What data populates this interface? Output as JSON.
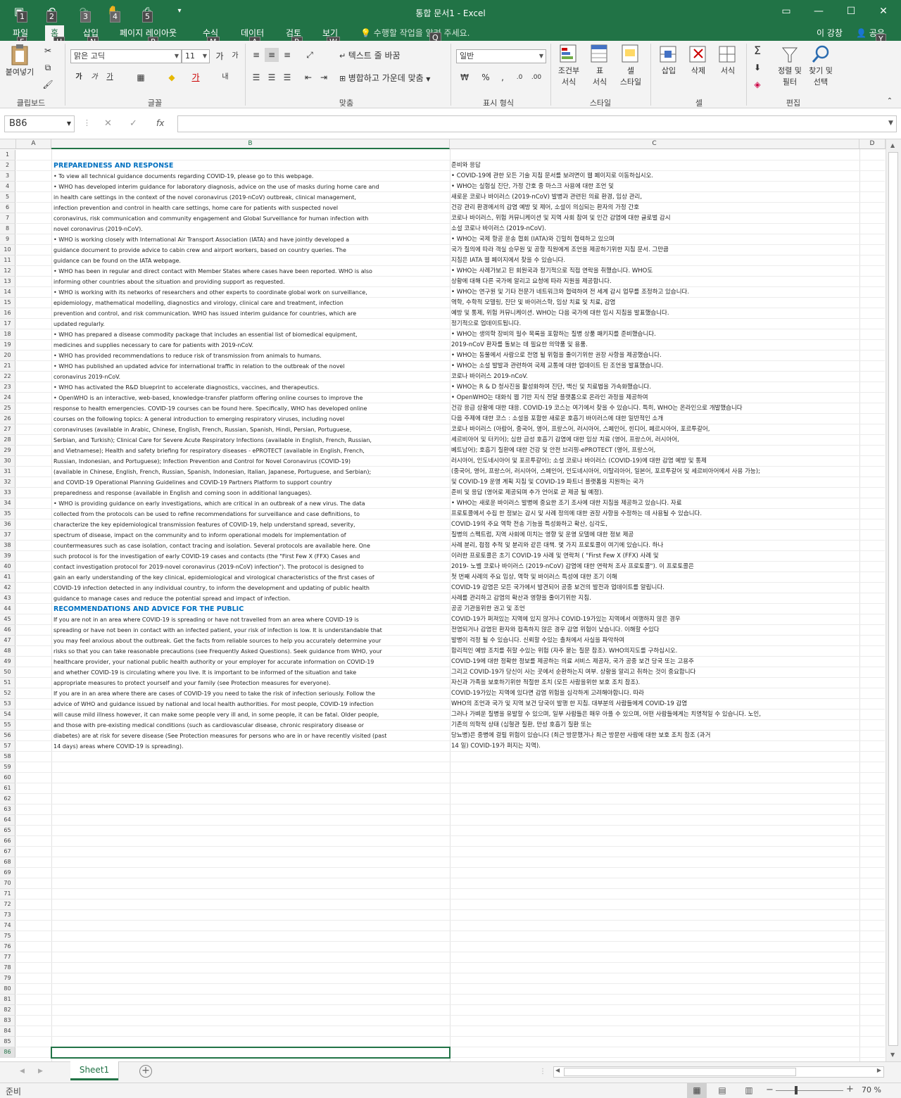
{
  "window": {
    "title": "통합 문서1 - Excel",
    "user": "이 강창",
    "share": "공유"
  },
  "qat_keys": [
    "1",
    "2",
    "3",
    "4",
    "5"
  ],
  "tabs": [
    {
      "label": "파일",
      "key": "F"
    },
    {
      "label": "홈",
      "key": "H"
    },
    {
      "label": "삽입",
      "key": "N"
    },
    {
      "label": "페이지 레이아웃",
      "key": "P"
    },
    {
      "label": "수식",
      "key": "M"
    },
    {
      "label": "데이터",
      "key": "A"
    },
    {
      "label": "검토",
      "key": "R"
    },
    {
      "label": "보기",
      "key": "W"
    }
  ],
  "tell_me": {
    "text": "수행할 작업을 알려 주세요.",
    "key": "Q"
  },
  "share_key": "Y",
  "ribbon": {
    "paste": "붙여넣기",
    "font_name": "맑은 고딕",
    "font_size": "11",
    "bold": "가",
    "italic": "가",
    "underline": "가",
    "wrap_text": "텍스트 줄 바꿈",
    "merge_center": "병합하고 가운데 맞춤",
    "number_format": "일반",
    "cond_format": [
      "조건부",
      "서식"
    ],
    "format_table": [
      "표",
      "서식"
    ],
    "cell_styles": [
      "셀",
      "스타일"
    ],
    "insert": "삽입",
    "delete": "삭제",
    "format": "서식",
    "sort_filter": [
      "정렬 및",
      "필터"
    ],
    "find_select": [
      "찾기 및",
      "선택"
    ],
    "groups": [
      "클립보드",
      "글꼴",
      "맞춤",
      "표시 형식",
      "스타일",
      "셀",
      "편집"
    ]
  },
  "formula_bar": {
    "name_box": "B86",
    "fx": "fx",
    "value": ""
  },
  "columns": [
    "A",
    "B",
    "C",
    "D"
  ],
  "rows_count": 86,
  "cells": {
    "B2": "PREPAREDNESS AND RESPONSE",
    "B3": "• To view all technical guidance documents regarding COVID-19, please go to this webpage.",
    "B4": "• WHO has developed interim guidance for laboratory diagnosis, advice on the use of masks during home care and",
    "B5": "in health care settings in the context of the novel coronavirus (2019-nCoV) outbreak, clinical management,",
    "B6": "infection prevention and control in health care settings, home care for patients with suspected novel",
    "B7": "coronavirus, risk communication and community engagement and Global Surveillance for human infection with",
    "B8": "novel coronavirus (2019-nCoV).",
    "B9": "• WHO is working closely with International Air Transport Association (IATA) and have jointly developed a",
    "B10": "guidance document to provide advice to cabin crew and airport workers, based on country queries. The",
    "B11": "guidance can be found on the IATA webpage.",
    "B12": "• WHO has been in regular and direct contact with Member States where cases have been reported. WHO is also",
    "B13": "informing other countries about the situation and providing support as requested.",
    "B14": "• WHO is working with its networks of researchers and other experts to coordinate global work on surveillance,",
    "B15": "epidemiology, mathematical modelling, diagnostics and virology, clinical care and treatment, infection",
    "B16": "prevention and control, and risk communication. WHO has issued interim guidance for countries, which are",
    "B17": "updated regularly.",
    "B18": "• WHO has prepared a disease commodity package that includes an essential list of biomedical equipment,",
    "B19": "medicines and supplies necessary to care for patients with 2019-nCoV.",
    "B20": "• WHO has provided recommendations to reduce risk of transmission from animals to humans.",
    "B21": "• WHO has published an updated advice for international traffic in relation to the outbreak of the novel",
    "B22": "coronavirus 2019-nCoV.",
    "B23": "• WHO has activated the R&D blueprint to accelerate diagnostics, vaccines, and therapeutics.",
    "B24": "• OpenWHO is an interactive, web-based, knowledge-transfer platform offering online courses to improve the",
    "B25": "response to health emergencies. COVID-19 courses can be found here. Specifically, WHO has developed online",
    "B26": "courses on the following topics: A general introduction to emerging respiratory viruses, including novel",
    "B27": "coronaviruses (available in Arabic, Chinese, English, French, Russian, Spanish, Hindi, Persian, Portuguese,",
    "B28": "Serbian, and Turkish); Clinical Care for Severe Acute Respiratory Infections (available in English, French, Russian,",
    "B29": "and Vietnamese); Health and safety briefing for respiratory diseases - ePROTECT (available in English, French,",
    "B30": "Russian, Indonesian, and Portuguese); Infection Prevention and Control for Novel Coronavirus (COVID-19)",
    "B31": "(available in Chinese, English, French, Russian, Spanish, Indonesian, Italian, Japanese, Portuguese, and Serbian);",
    "B32": "and COVID-19 Operational Planning Guidelines and COVID-19 Partners Platform to support country",
    "B33": "preparedness and response (available in English and coming soon in additional languages).",
    "B34": "• WHO is providing guidance on early investigations, which are critical in an outbreak of a new virus. The data",
    "B35": "collected from the protocols can be used to refine recommendations for surveillance and case definitions, to",
    "B36": "characterize the key epidemiological transmission features of COVID-19, help understand spread, severity,",
    "B37": "spectrum of disease, impact on the community and to inform operational models for implementation of",
    "B38": "countermeasures such as case isolation, contact tracing and isolation. Several protocols are available here. One",
    "B39": "such protocol is for the investigation of early COVID-19 cases and contacts (the \"First Few X (FFX) Cases and",
    "B40": "contact investigation protocol for 2019-novel coronavirus (2019-nCoV) infection\"). The protocol is designed to",
    "B41": "gain an early understanding of the key clinical, epidemiological and virological characteristics of the first cases of",
    "B42": "COVID-19 infection detected in any individual country, to inform the development and updating of public health",
    "B43": "guidance to manage cases and reduce the potential spread and impact of infection.",
    "B44": "RECOMMENDATIONS AND ADVICE FOR THE PUBLIC",
    "B45": "If you are not in an area where COVID-19 is spreading or have not travelled from an area where COVID-19 is",
    "B46": "spreading or have not been in contact with an infected patient, your risk of infection is low. It is understandable that",
    "B47": "you may feel anxious about the outbreak. Get the facts from reliable sources to help you accurately determine your",
    "B48": "risks so that you can take reasonable precautions (see Frequently Asked Questions). Seek guidance from WHO, your",
    "B49": "healthcare provider, your national public health authority or your employer for accurate information on COVID-19",
    "B50": "and whether COVID-19 is circulating where you live. It is important to be informed of the situation and take",
    "B51": "appropriate measures to protect yourself and your family (see Protection measures for everyone).",
    "B52": "If you are in an area where there are cases of COVID-19 you need to take the risk of infection seriously. Follow the",
    "B53": "advice of WHO and guidance issued by national and local health authorities. For most people, COVID-19 infection",
    "B54": "will cause mild illness however, it can make some people very ill and, in some people, it can be fatal. Older people,",
    "B55": "and those with pre-existing medical conditions (such as cardiovascular disease, chronic respiratory disease or",
    "B56": "diabetes) are at risk for severe disease (See Protection measures for persons who are in or have recently visited (past",
    "B57": "14 days) areas where COVID-19 is spreading).",
    "C2": "준비와 응답",
    "C3": "• COVID-19에 관한 모든 기술 지침 문서를 보려면이 웹 페이지로 이동하십시오.",
    "C4": "• WHO는 실험실 진단, 가정 간호 중 마스크 사용에 대한 조언 및",
    "C5": "새로운 코로나 바이러스 (2019-nCoV) 발병과 관련된 의료 환경, 임상 관리,",
    "C6": "건강 관리 환경에서의 감염 예방 및 제어, 소설이 의심되는 환자의 가정 간호",
    "C7": "코로나 바이러스, 위험 커뮤니케이션 및 지역 사회 참여 및 인간 감염에 대한 글로벌 감시",
    "C8": "소설 코로나 바이러스 (2019-nCoV).",
    "C9": "• WHO는 국제 항공 운송 협회 (IATA)와 긴밀히 협력하고 있으며",
    "C10": "국가 질의에 따라 객실 승무원 및 공항 직원에게 조언을 제공하기위한 지침 문서. 그만큼",
    "C11": "지침은 IATA 웹 페이지에서 찾을 수 있습니다.",
    "C12": "• WHO는 사례가보고 된 회원국과 정기적으로 직접 연락을 취했습니다. WHO도",
    "C13": "상황에 대해 다른 국가에 알리고 요청에 따라 지원을 제공합니다.",
    "C14": "• WHO는 연구원 및 기타 전문가 네트워크와 협력하여 전 세계 감시 업무를 조정하고 있습니다.",
    "C15": "역학, 수학적 모델링, 진단 및 바이러스학, 임상 치료 및 치료, 감염",
    "C16": "예방 및 통제, 위험 커뮤니케이션. WHO는 다음 국가에 대한 임시 지침을 발표했습니다.",
    "C17": "정기적으로 업데이트됩니다.",
    "C18": "• WHO는 생의학 장비의 필수 목록을 포함하는 질병 상품 패키지를 준비했습니다.",
    "C19": "2019-nCoV 환자를 돌보는 데 필요한 의약품 및 용품.",
    "C20": "• WHO는 동물에서 사람으로 전염 될 위험을 줄이기위한 권장 사항을 제공했습니다.",
    "C21": "• WHO는 소설 발발과 관련하여 국제 교통에 대한 업데이트 된 조언을 발표했습니다.",
    "C22": "코로나 바이러스 2019-nCoV.",
    "C23": "• WHO는 R & D 청사진을 활성화하여 진단, 백신 및 치료법을 가속화했습니다.",
    "C24": "• OpenWHO는 대화식 웹 기반 지식 전달 플랫폼으로 온라인 과정을 제공하여",
    "C25": "건강 응급 상황에 대한 대응. COVID-19 코스는 여기에서 찾을 수 있습니다. 특히, WHO는 온라인으로 개발했습니다",
    "C26": "다음 주제에 대한 코스 : 소설을 포함한 새로운 호흡기 바이러스에 대한 일반적인 소개",
    "C27": "코로나 바이러스 (아랍어, 중국어, 영어, 프랑스어, 러시아어, 스페인어, 힌디어, 페르시아어, 포르투갈어,",
    "C28": "세르비아어 및 터키어); 심한 급성 호흡기 감염에 대한 임상 치료 (영어, 프랑스어, 러시아어,",
    "C29": "베트남어); 호흡기 질환에 대한 건강 및 안전 브리핑-ePROTECT (영어, 프랑스어,",
    "C30": "러시아어, 인도네시아어 및 포르투갈어); 소설 코로나 바이러스 (COVID-19)에 대한 감염 예방 및 통제",
    "C31": "(중국어, 영어, 프랑스어, 러시아어, 스페인어, 인도네시아어, 이탈리아어, 일본어, 포르투갈어 및 세르비아어에서 사용 가능);",
    "C32": "및 COVID-19 운영 계획 지침 및 COVID-19 파트너 플랫폼을 지원하는 국가",
    "C33": "준비 및 응답 (영어로 제공되며 추가 언어로 곧 제공 될 예정).",
    "C34": "• WHO는 새로운 바이러스 발병에 중요한 조기 조사에 대한 지침을 제공하고 있습니다. 자료",
    "C35": "프로토콜에서 수집 한 정보는 감시 및 사례 정의에 대한 권장 사항을 수정하는 데 사용될 수 있습니다.",
    "C36": "COVID-19의 주요 역학 전송 기능을 특성화하고 확산, 심각도,",
    "C37": "질병의 스펙트럼, 지역 사회에 미치는 영향 및 운영 모델에 대한 정보 제공",
    "C38": "사례 분리, 접점 추적 및 분리와 같은 대책. 몇 가지 프로토콜이 여기에 있습니다. 하나",
    "C39": "이러한 프로토콜은 초기 COVID-19 사례 및 연락처 ( \"First Few X (FFX) 사례 및",
    "C40": "2019- 노벨 코로나 바이러스 (2019-nCoV) 감염에 대한 연락처 조사 프로토콜\"). 이 프로토콜은",
    "C41": "첫 번째 사례의 주요 임상, 역학 및 바이러스 특성에 대한 조기 이해",
    "C42": "COVID-19 감염은 모든 국가에서 발견되어 공중 보건의 발전과 업데이트를 알립니다.",
    "C43": "사례를 관리하고 감염의 확산과 영향을 줄이기위한 지침.",
    "C44": "공공 기관을위한 권고 및 조언",
    "C45": "COVID-19가 퍼져있는 지역에 있지 않거나 COVID-19가있는 지역에서 여행하지 않은 경우",
    "C46": "전염되거나 감염된 환자와 접촉하지 않은 경우 감염 위험이 낮습니다. 이해할 수있다",
    "C47": "발병이 걱정 될 수 있습니다. 신뢰할 수있는 출처에서 사실을 파악하여",
    "C48": "합리적인 예방 조치를 취할 수있는 위험 (자주 묻는 질문 참조). WHO의지도를 구하십시오.",
    "C49": "COVID-19에 대한 정확한 정보를 제공하는 의료 서비스 제공자, 국가 공중 보건 당국 또는 고용주",
    "C50": "그리고 COVID-19가 당신이 사는 곳에서 순환하는지 여부. 상황을 알리고 취하는 것이 중요합니다",
    "C51": "자신과 가족을 보호하기위한 적절한 조치 (모든 사람을위한 보호 조치 참조).",
    "C52": "COVID-19가있는 지역에 있다면 감염 위험을 심각하게 고려해야합니다. 따라",
    "C53": "WHO의 조언과 국가 및 지역 보건 당국이 발행 한 지침. 대부분의 사람들에게 COVID-19 감염",
    "C54": "그러나 가벼운 질병을 유발할 수 있으며, 일부 사람들은 매우 아플 수 있으며, 어떤 사람들에게는 치명적일 수 있습니다. 노인,",
    "C55": "기존의 의학적 상태 (심혈관 질환, 만성 호흡기 질환 또는",
    "C56": "당뇨병)은 중병에 걸릴 위험이 있습니다 (최근 방문했거나 최근 방문한 사람에 대한 보호 조치 참조 (과거",
    "C57": "14 일) COVID-19가 퍼지는 지역)."
  },
  "heading_rows": [
    2,
    44
  ],
  "link_rows": [],
  "sheet_tab": "Sheet1",
  "status": {
    "ready": "준비",
    "zoom": "70 %"
  }
}
